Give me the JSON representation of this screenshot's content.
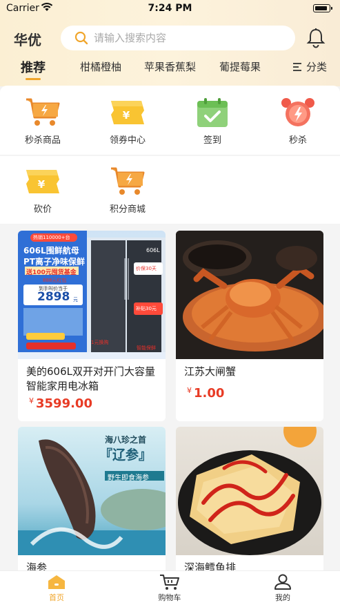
{
  "status_bar": {
    "carrier": "Carrier",
    "time": "7:24 PM"
  },
  "header": {
    "brand": "华优",
    "search_placeholder": "请输入搜索内容"
  },
  "tabs": [
    {
      "label": "推荐",
      "active": true
    },
    {
      "label": "柑橘橙柚"
    },
    {
      "label": "苹果香蕉梨"
    },
    {
      "label": "葡提莓果"
    }
  ],
  "categories_label": "分类",
  "quick_actions": [
    {
      "label": "秒杀商品",
      "icon": "cart-flash-icon"
    },
    {
      "label": "领券中心",
      "icon": "coupon-icon"
    },
    {
      "label": "签到",
      "icon": "calendar-check-icon"
    },
    {
      "label": "秒杀",
      "icon": "alarm-clock-icon"
    },
    {
      "label": "砍价",
      "icon": "coupon-icon"
    },
    {
      "label": "积分商城",
      "icon": "cart-flash-icon"
    }
  ],
  "products": [
    {
      "name": "美的606L双开对开门大容量智能家用电冰箱",
      "currency": "¥",
      "price": "3599.00",
      "image": "refrigerator-image",
      "image_texts": {
        "top_badge": "热销110000+台",
        "line1": "606L围鲜航母",
        "line2": "PT离子净味保鲜",
        "line3": "送100元囤货基金",
        "badge_888": "888元红包",
        "price_label": "到手叫价当于",
        "price_big": "2898",
        "price_unit": "元",
        "capacity": "606L",
        "side1": "价保30天",
        "side2": "补贴30元",
        "bottom1": "1元换购",
        "bottom2": "智能保鲜"
      }
    },
    {
      "name": "江苏大闸蟹",
      "currency": "¥",
      "price": "1.00",
      "image": "crab-image"
    },
    {
      "name": "海参",
      "image": "sea-cucumber-image",
      "image_texts": {
        "line1": "海八珍之首",
        "line2": "『辽参』",
        "line3": "野生即食海参"
      }
    },
    {
      "name": "深海鳕鱼排",
      "image": "fish-fillet-image"
    }
  ],
  "tabbar": [
    {
      "label": "首页",
      "active": true
    },
    {
      "label": "购物车"
    },
    {
      "label": "我的"
    }
  ],
  "colors": {
    "accent": "#f0a52b",
    "price": "#e83b25"
  }
}
